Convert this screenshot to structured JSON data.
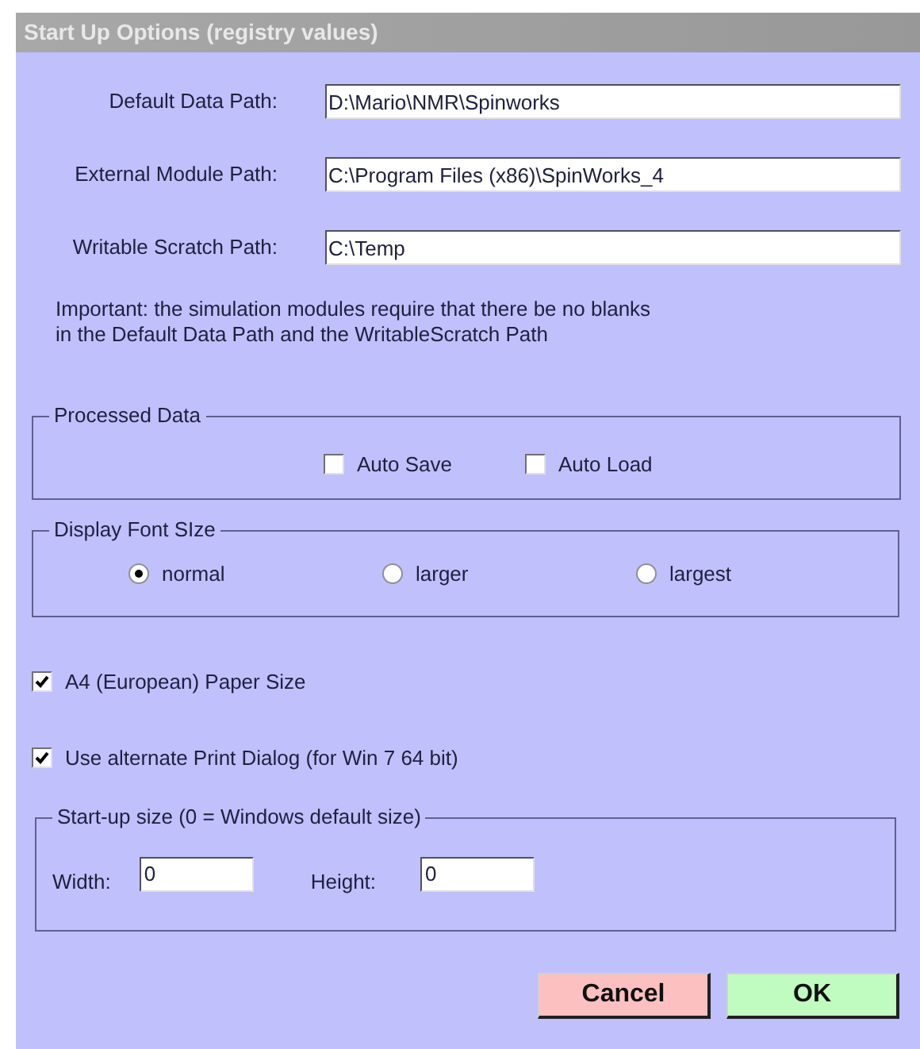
{
  "window": {
    "title": "Start Up Options (registry values)"
  },
  "paths": [
    {
      "label": "Default Data Path:",
      "value": "D:\\Mario\\NMR\\Spinworks"
    },
    {
      "label": "External Module Path:",
      "value": "C:\\Program Files (x86)\\SpinWorks_4"
    },
    {
      "label": "Writable Scratch Path:",
      "value": "C:\\Temp"
    }
  ],
  "note": [
    "Important:  the simulation modules require that there be no blanks",
    "in the Default Data Path and the WritableScratch Path"
  ],
  "processed_data": {
    "title": "Processed Data",
    "options": [
      {
        "label": "Auto Save",
        "checked": false
      },
      {
        "label": "Auto Load",
        "checked": false
      }
    ]
  },
  "font_size": {
    "title": "Display Font SIze",
    "options": [
      {
        "label": "normal",
        "selected": true
      },
      {
        "label": "larger",
        "selected": false
      },
      {
        "label": "largest",
        "selected": false
      }
    ]
  },
  "checks": [
    {
      "label": "A4 (European) Paper Size",
      "checked": true
    },
    {
      "label": "Use alternate Print Dialog (for Win 7 64 bit)",
      "checked": true
    }
  ],
  "startup_size": {
    "title": "Start-up size (0 = Windows default size)",
    "width_label": "Width:",
    "width_value": "0",
    "height_label": "Height:",
    "height_value": "0"
  },
  "buttons": [
    {
      "label": "Cancel",
      "kind": "cancel"
    },
    {
      "label": "OK",
      "kind": "ok"
    }
  ]
}
